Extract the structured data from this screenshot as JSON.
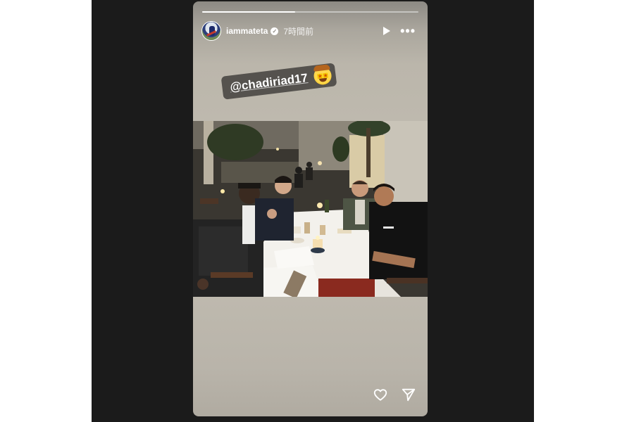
{
  "story": {
    "progress_fraction": 0.43,
    "author": {
      "username": "iammateta",
      "verified": true,
      "posted_ago": "7時間前"
    },
    "header_icons": [
      "play-icon",
      "more-options-icon"
    ],
    "mention_sticker": {
      "handle": "@chadiriad17",
      "emoji": "star-struck-cowboy-emoji"
    },
    "photo": {
      "subject": "restaurant-dinner-photo"
    },
    "footer_icons": [
      "heart-icon",
      "share-send-icon"
    ]
  },
  "colors": {
    "page_backdrop": "#1b1b1b",
    "story_background": "#beb9ae",
    "sticker_background": "#55524e",
    "text": "#ffffff"
  }
}
